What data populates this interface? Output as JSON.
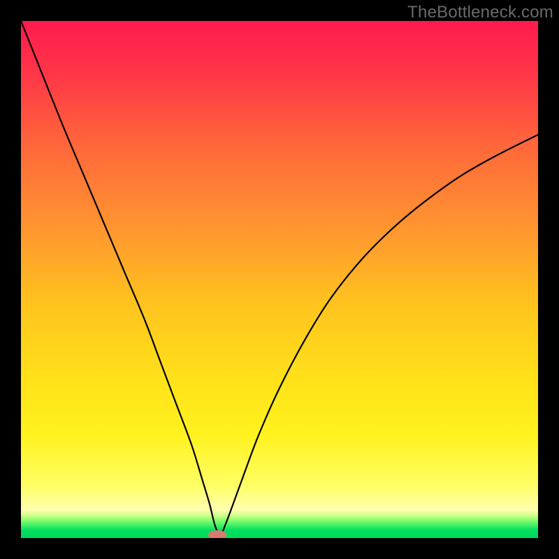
{
  "watermark": "TheBottleneck.com",
  "chart_data": {
    "type": "line",
    "title": "",
    "xlabel": "",
    "ylabel": "",
    "xlim": [
      0,
      100
    ],
    "ylim": [
      0,
      100
    ],
    "grid": false,
    "legend": false,
    "notes": "Background is a vertical gradient from red (top) through orange and yellow to pale-yellow near the bottom, with a thin bright-green band at the very bottom. A single black V-shaped curve dips to ~0 near x≈38 with a small salmon marker at the minimum.",
    "gradient_stops": [
      {
        "offset": 0.0,
        "color": "#ff1a4d"
      },
      {
        "offset": 0.1,
        "color": "#ff3648"
      },
      {
        "offset": 0.25,
        "color": "#ff6a3a"
      },
      {
        "offset": 0.4,
        "color": "#ff9530"
      },
      {
        "offset": 0.55,
        "color": "#ffc41e"
      },
      {
        "offset": 0.7,
        "color": "#ffe21a"
      },
      {
        "offset": 0.8,
        "color": "#fff21e"
      },
      {
        "offset": 0.9,
        "color": "#ffff66"
      },
      {
        "offset": 0.945,
        "color": "#ffffb0"
      },
      {
        "offset": 0.955,
        "color": "#d8ff90"
      },
      {
        "offset": 0.965,
        "color": "#8cff70"
      },
      {
        "offset": 0.985,
        "color": "#00e060"
      },
      {
        "offset": 1.0,
        "color": "#00d858"
      }
    ],
    "series": [
      {
        "name": "curve",
        "color": "#000000",
        "stroke_width": 2.2,
        "x": [
          0,
          4,
          8,
          12,
          16,
          20,
          24,
          27,
          30,
          33,
          35,
          36.5,
          37.5,
          38.5,
          39.5,
          41,
          43,
          46,
          50,
          55,
          60,
          66,
          72,
          78,
          85,
          92,
          100
        ],
        "y": [
          100,
          90,
          80,
          70.5,
          61,
          51.5,
          42,
          34,
          26,
          18,
          11.5,
          6.5,
          2.5,
          0.5,
          2.5,
          6.5,
          12,
          20,
          29,
          38.5,
          46.5,
          54,
          60,
          65,
          70,
          74,
          78
        ]
      }
    ],
    "marker": {
      "x": 38,
      "y": 0.6,
      "rx": 1.8,
      "ry": 0.9,
      "color": "#d97a72"
    }
  }
}
